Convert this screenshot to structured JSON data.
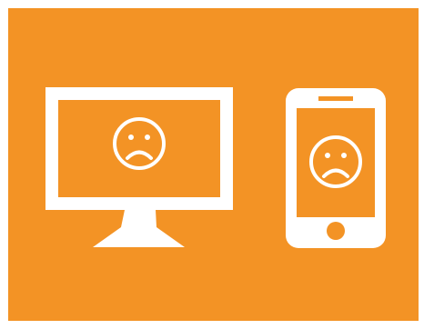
{
  "colors": {
    "background": "#F39325",
    "foreground": "#FFFFFF"
  },
  "devices": [
    {
      "type": "desktop-monitor",
      "icon": "sad-face-icon"
    },
    {
      "type": "smartphone",
      "icon": "sad-face-icon"
    }
  ]
}
